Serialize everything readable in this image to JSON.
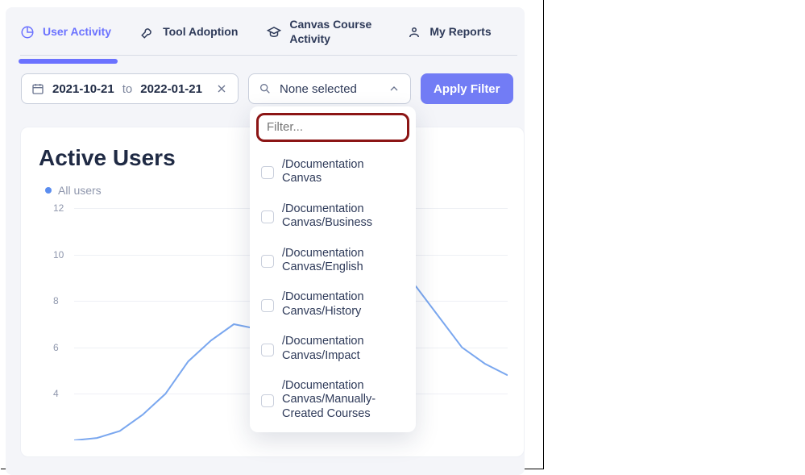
{
  "tabs": {
    "user_activity": "User\nActivity",
    "tool_adoption": "Tool\nAdoption",
    "canvas_course": "Canvas Course\nActivity",
    "my_reports": "My\nReports"
  },
  "filters": {
    "date_from": "2021-10-21",
    "date_to_word": "to",
    "date_to": "2022-01-21",
    "select_placeholder": "None selected",
    "apply_label": "Apply Filter",
    "filter_placeholder": "Filter..."
  },
  "dropdown_options": [
    "/Documentation Canvas",
    "/Documentation Canvas/Business",
    "/Documentation Canvas/English",
    "/Documentation Canvas/History",
    "/Documentation Canvas/Impact",
    "/Documentation Canvas/Manually-Created Courses"
  ],
  "chart": {
    "title": "Active Users",
    "legend_all_users": "All users"
  },
  "chart_data": {
    "type": "line",
    "title": "Active Users",
    "ylabel": "",
    "xlabel": "",
    "ylim": [
      2,
      12
    ],
    "yticks": [
      4,
      6,
      8,
      10,
      12
    ],
    "series": [
      {
        "name": "All users",
        "values": [
          2.0,
          2.1,
          2.4,
          3.1,
          4.0,
          5.4,
          6.3,
          7.0,
          6.8,
          7.2,
          8.2,
          9.4,
          9.9,
          10.0,
          9.6,
          8.6,
          7.3,
          6.0,
          5.3,
          4.8
        ]
      }
    ]
  },
  "colors": {
    "accent": "#727cf5",
    "line": "#7aa7ef",
    "highlight_border": "#8c1515"
  }
}
